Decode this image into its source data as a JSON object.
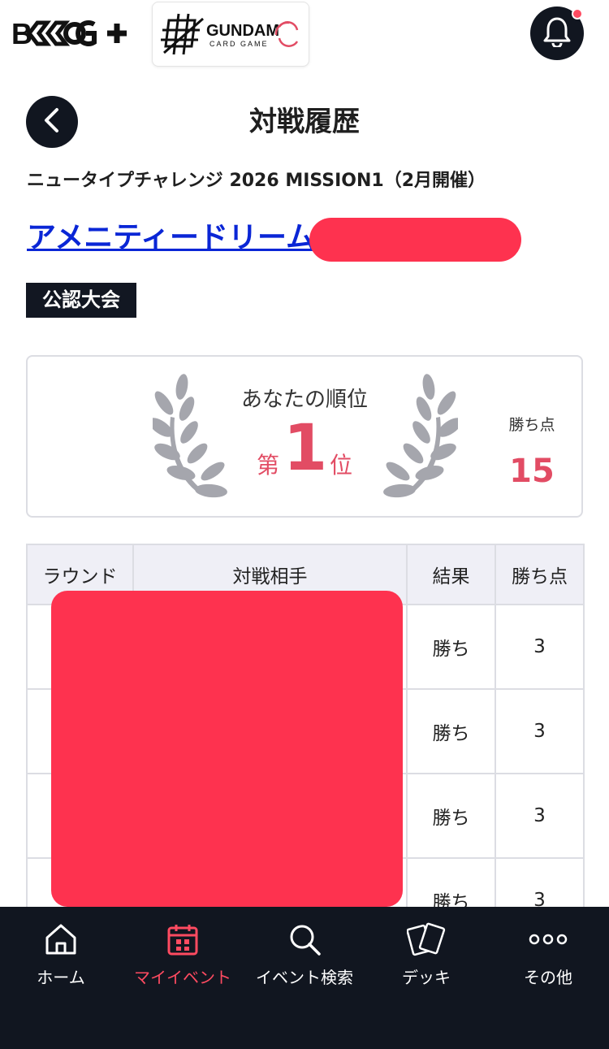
{
  "header": {
    "brand_logo": "B-CG+",
    "game_logo_line1": "GUNDAM",
    "game_logo_line2": "CARD GAME",
    "notification_icon": "bell-icon",
    "colors": {
      "dark": "#111620",
      "accent": "#e24c64",
      "redaction": "#fe324f"
    }
  },
  "page": {
    "title": "対戦履歴",
    "event_name": "ニュータイプチャレンジ 2026 MISSION1（2月開催）",
    "store_name": "アメニティードリーム",
    "badge": "公認大会"
  },
  "rank": {
    "label": "あなたの順位",
    "prefix": "第",
    "value": "1",
    "suffix": "位",
    "points_label": "勝ち点",
    "points_value": "15"
  },
  "table": {
    "headers": [
      "ラウンド",
      "対戦相手",
      "結果",
      "勝ち点"
    ],
    "rows": [
      {
        "result": "勝ち",
        "points": "3"
      },
      {
        "result": "勝ち",
        "points": "3"
      },
      {
        "result": "勝ち",
        "points": "3"
      },
      {
        "result": "勝ち",
        "points": "3"
      }
    ]
  },
  "nav": {
    "items": [
      {
        "label": "ホーム",
        "icon": "home-icon"
      },
      {
        "label": "マイイベント",
        "icon": "calendar-icon",
        "active": true
      },
      {
        "label": "イベント検索",
        "icon": "search-icon"
      },
      {
        "label": "デッキ",
        "icon": "cards-icon"
      },
      {
        "label": "その他",
        "icon": "more-icon"
      }
    ]
  }
}
